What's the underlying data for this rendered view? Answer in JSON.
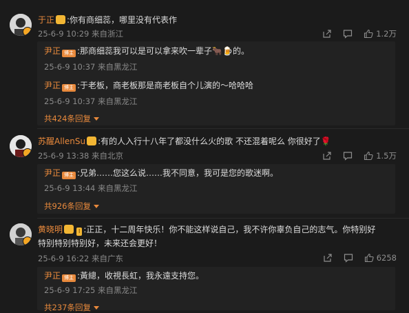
{
  "comments": [
    {
      "user": "于正",
      "text": ":你有商细蕊，哪里没有代表作",
      "meta": "25-6-9 10:29 来自浙江",
      "likes": "1.2万",
      "replies": [
        {
          "user": "尹正",
          "badge": "博主",
          "text": ":那商细蕊我可以是可以拿来吹一辈子",
          "emoji": "🐂🍺",
          "tail": "的。",
          "meta": "25-6-9 10:37 来自黑龙江"
        },
        {
          "user": "尹正",
          "badge": "博主",
          "text": ":于老板，商老板那是商老板自个儿演的～哈哈哈",
          "meta": "25-6-9 10:37 来自黑龙江"
        }
      ],
      "more": "共424条回复"
    },
    {
      "user": "苏醒AllenSu",
      "text": ":有的人入行十八年了都没什么火的歌 不还混着呢么 你很好了",
      "emoji": "🌹",
      "meta": "25-6-9 13:38 来自北京",
      "likes": "1.5万",
      "replies": [
        {
          "user": "尹正",
          "badge": "博主",
          "text": ":兄弟……您这么说……我不同意，我可是您的歌迷啊。",
          "meta": "25-6-9 13:44 来自黑龙江"
        }
      ],
      "more": "共926条回复"
    },
    {
      "user": "黄晓明",
      "text_line1": ":正正，十二周年快乐！你不能这样说自己，我不许你辜负自己的志气。你特别好",
      "text_line2": "特别特别特别好，未来还会更好！",
      "meta": "25-6-9 16:22 来自广东",
      "likes": "6258",
      "replies": [
        {
          "user": "尹正",
          "badge": "博主",
          "text": ":黃總，收視長虹，我永遠支持您。",
          "meta": "25-6-9 17:25 来自黑龙江"
        }
      ],
      "more": "共237条回复"
    }
  ],
  "icons": {
    "share": "share-icon",
    "comment": "comment-icon",
    "like": "like-icon",
    "more": "chevron-down-icon"
  },
  "colors": {
    "username": "#e8893c",
    "background": "#1b1b1b",
    "reply_bg": "#222222",
    "meta": "#8a8a8a"
  }
}
